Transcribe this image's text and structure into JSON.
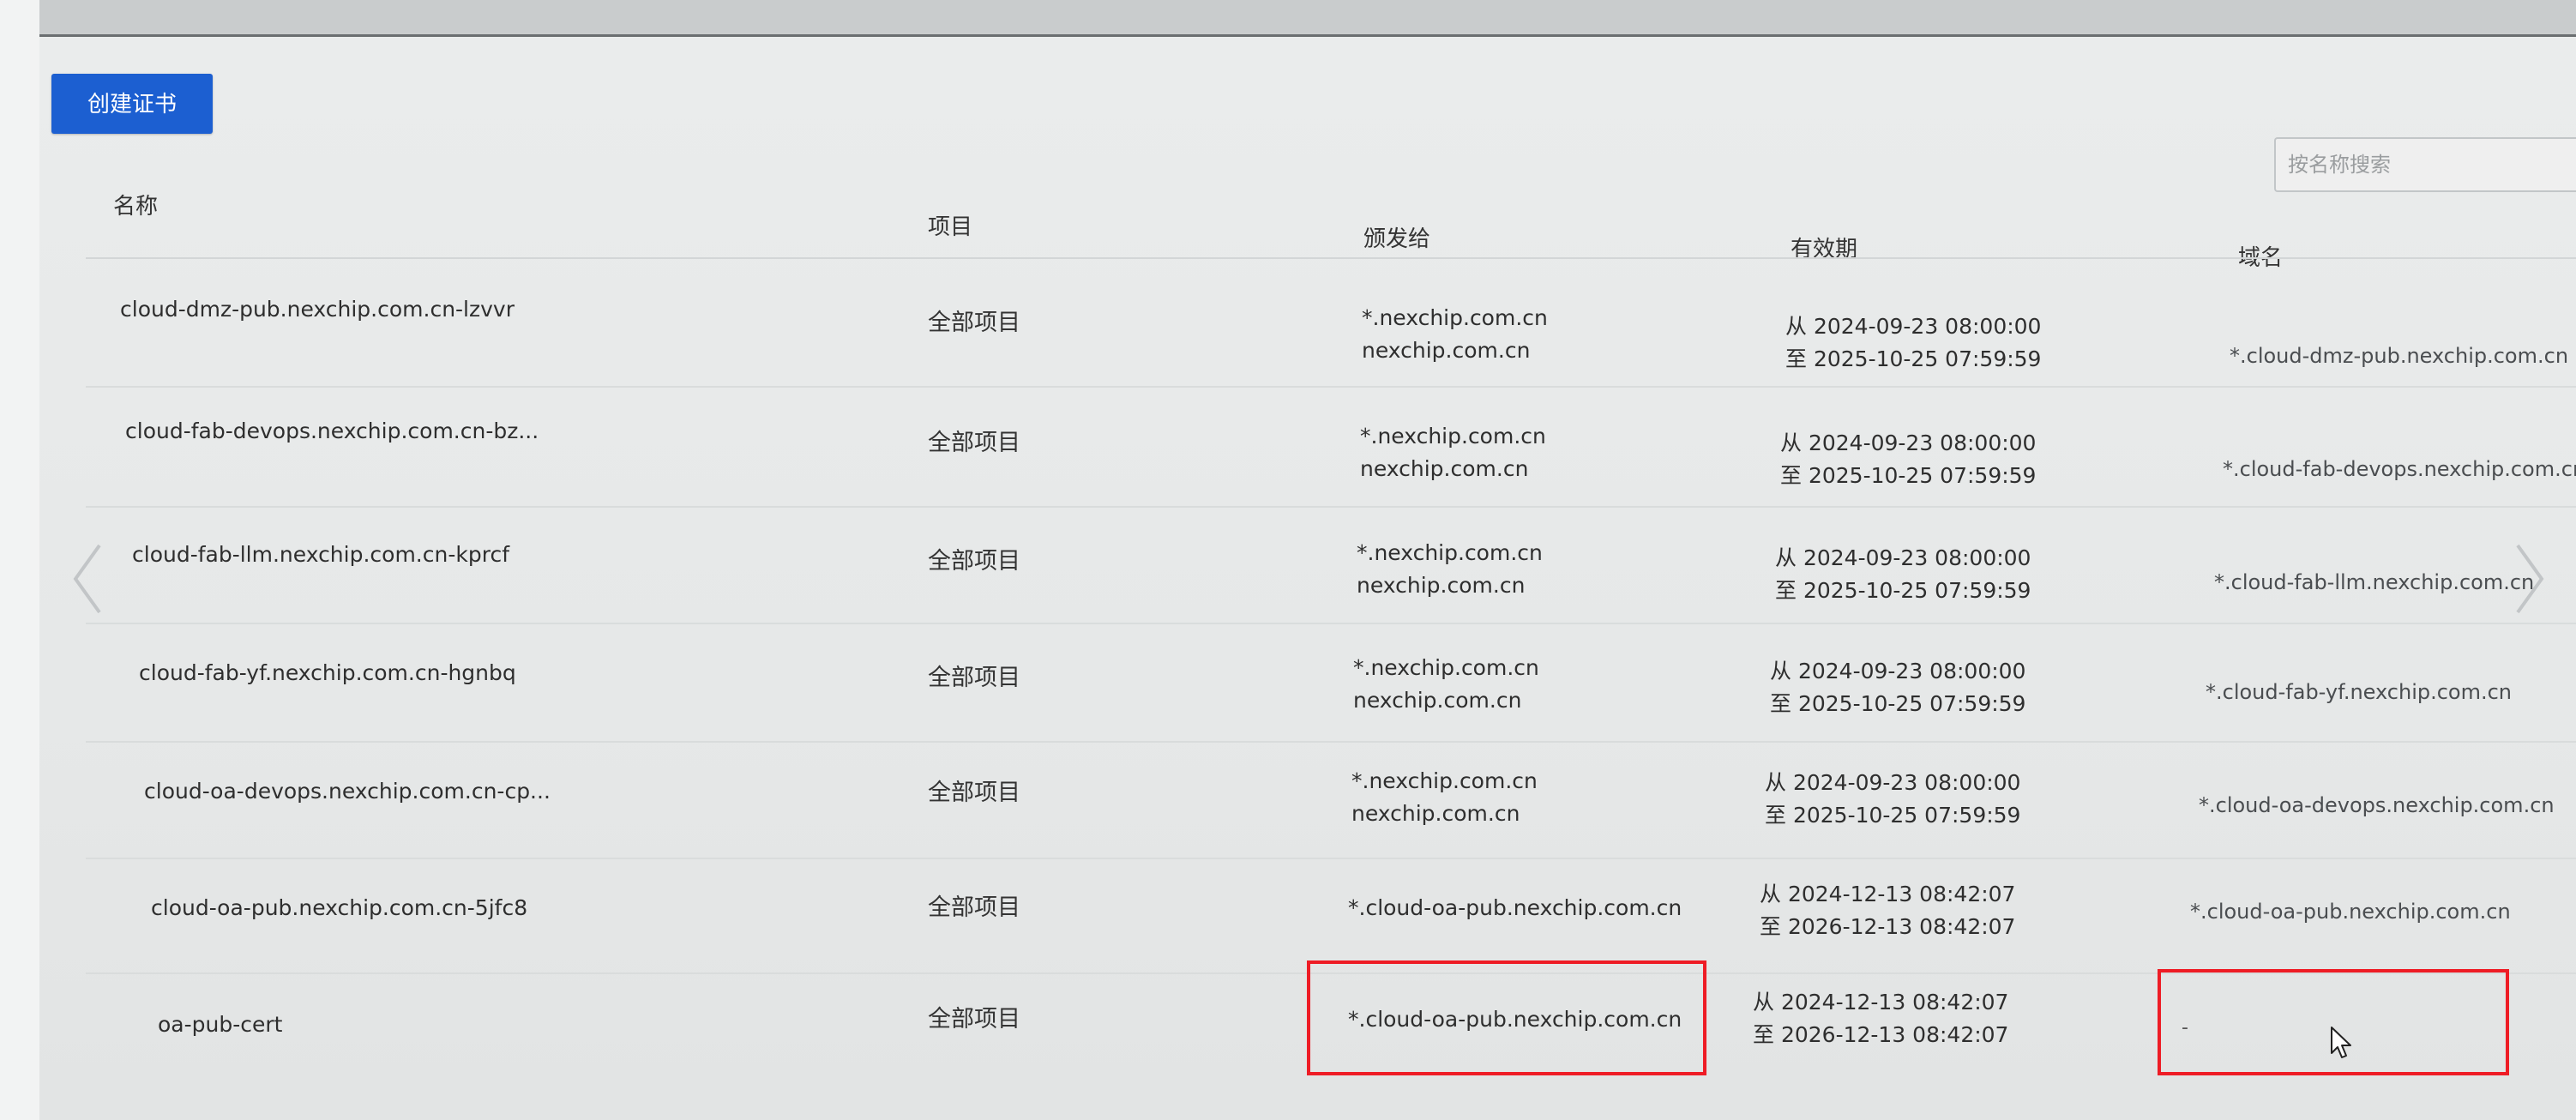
{
  "toolbar": {
    "create_label": "创建证书",
    "search_placeholder": "按名称搜索"
  },
  "table": {
    "columns": {
      "name": "名称",
      "project": "项目",
      "issued_to": "颁发给",
      "validity": "有效期",
      "domain": "域名"
    },
    "rows": [
      {
        "name": "cloud-dmz-pub.nexchip.com.cn-lzvvr",
        "project": "全部项目",
        "issued_to": [
          "*.nexchip.com.cn",
          "nexchip.com.cn"
        ],
        "validity": [
          "从 2024-09-23 08:00:00",
          "至 2025-10-25 07:59:59"
        ],
        "domain": "*.cloud-dmz-pub.nexchip.com.cn"
      },
      {
        "name": "cloud-fab-devops.nexchip.com.cn-bz...",
        "project": "全部项目",
        "issued_to": [
          "*.nexchip.com.cn",
          "nexchip.com.cn"
        ],
        "validity": [
          "从 2024-09-23 08:00:00",
          "至 2025-10-25 07:59:59"
        ],
        "domain": "*.cloud-fab-devops.nexchip.com.cn"
      },
      {
        "name": "cloud-fab-llm.nexchip.com.cn-kprcf",
        "project": "全部项目",
        "issued_to": [
          "*.nexchip.com.cn",
          "nexchip.com.cn"
        ],
        "validity": [
          "从 2024-09-23 08:00:00",
          "至 2025-10-25 07:59:59"
        ],
        "domain": "*.cloud-fab-llm.nexchip.com.cn"
      },
      {
        "name": "cloud-fab-yf.nexchip.com.cn-hgnbq",
        "project": "全部项目",
        "issued_to": [
          "*.nexchip.com.cn",
          "nexchip.com.cn"
        ],
        "validity": [
          "从 2024-09-23 08:00:00",
          "至 2025-10-25 07:59:59"
        ],
        "domain": "*.cloud-fab-yf.nexchip.com.cn"
      },
      {
        "name": "cloud-oa-devops.nexchip.com.cn-cp...",
        "project": "全部项目",
        "issued_to": [
          "*.nexchip.com.cn",
          "nexchip.com.cn"
        ],
        "validity": [
          "从 2024-09-23 08:00:00",
          "至 2025-10-25 07:59:59"
        ],
        "domain": "*.cloud-oa-devops.nexchip.com.cn"
      },
      {
        "name": "cloud-oa-pub.nexchip.com.cn-5jfc8",
        "project": "全部项目",
        "issued_to": [
          "*.cloud-oa-pub.nexchip.com.cn"
        ],
        "validity": [
          "从 2024-12-13 08:42:07",
          "至 2026-12-13 08:42:07"
        ],
        "domain": "*.cloud-oa-pub.nexchip.com.cn"
      },
      {
        "name": "oa-pub-cert",
        "project": "全部项目",
        "issued_to": [
          "*.cloud-oa-pub.nexchip.com.cn"
        ],
        "validity": [
          "从 2024-12-13 08:42:07",
          "至 2026-12-13 08:42:07"
        ],
        "domain": "-"
      }
    ]
  },
  "colors": {
    "primary": "#1c5fd1",
    "highlight": "#ee1c25"
  }
}
